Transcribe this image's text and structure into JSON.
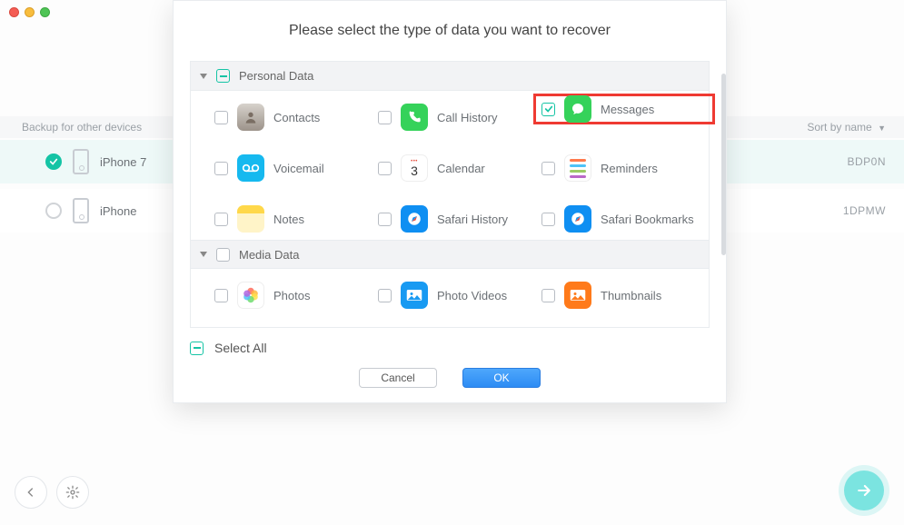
{
  "window": {
    "traffic_lights": {
      "close": "#f45c53",
      "min": "#f8bd3d",
      "max": "#4ec455"
    }
  },
  "device_list": {
    "header_left": "Backup for other devices",
    "header_right": "Sort by name",
    "rows": [
      {
        "name": "iPhone 7",
        "id": "BDP0N",
        "selected": true
      },
      {
        "name": "iPhone",
        "id": "1DPMW",
        "selected": false
      }
    ]
  },
  "modal": {
    "title": "Please select the type of data you want to recover",
    "categories": [
      {
        "name": "Personal Data",
        "checkbox_state": "partial",
        "items": [
          {
            "label": "Contacts",
            "icon": "contacts-icon",
            "checked": false
          },
          {
            "label": "Call History",
            "icon": "call-history-icon",
            "checked": false
          },
          {
            "label": "Messages",
            "icon": "messages-icon",
            "checked": true,
            "highlighted": true
          },
          {
            "label": "Voicemail",
            "icon": "voicemail-icon",
            "checked": false
          },
          {
            "label": "Calendar",
            "icon": "calendar-icon",
            "checked": false,
            "calendar_day": "3"
          },
          {
            "label": "Reminders",
            "icon": "reminders-icon",
            "checked": false
          },
          {
            "label": "Notes",
            "icon": "notes-icon",
            "checked": false
          },
          {
            "label": "Safari History",
            "icon": "safari-history-icon",
            "checked": false
          },
          {
            "label": "Safari Bookmarks",
            "icon": "safari-bookmarks-icon",
            "checked": false
          }
        ]
      },
      {
        "name": "Media Data",
        "checkbox_state": "unchecked",
        "items": [
          {
            "label": "Photos",
            "icon": "photos-icon",
            "checked": false
          },
          {
            "label": "Photo Videos",
            "icon": "photo-videos-icon",
            "checked": false
          },
          {
            "label": "Thumbnails",
            "icon": "thumbnails-icon",
            "checked": false
          }
        ]
      }
    ],
    "select_all_label": "Select All",
    "select_all_state": "partial",
    "buttons": {
      "cancel": "Cancel",
      "ok": "OK"
    }
  },
  "footer_icons": {
    "back": "back-arrow",
    "settings": "gear"
  },
  "next_button": "forward-arrow"
}
